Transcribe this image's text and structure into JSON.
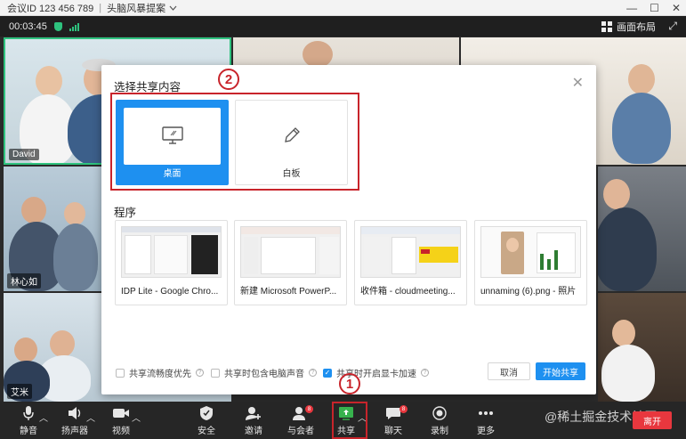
{
  "titlebar": {
    "meeting_id": "会议ID 123 456 789",
    "topic": "头脑风暴提案",
    "chevron": "chevron-down-icon"
  },
  "infobar": {
    "timer": "00:03:45",
    "layout_label": "画面布局"
  },
  "participants": [
    {
      "name": "David"
    },
    {
      "name": "林心如"
    },
    {
      "name": "艾米"
    }
  ],
  "dialog": {
    "title": "选择共享内容",
    "options": [
      {
        "label": "桌面",
        "icon": "monitor-icon",
        "selected": true
      },
      {
        "label": "白板",
        "icon": "pen-icon",
        "selected": false
      }
    ],
    "programs_label": "程序",
    "programs": [
      {
        "label": "IDP Lite - Google Chro..."
      },
      {
        "label": "新建 Microsoft PowerP..."
      },
      {
        "label": "收件箱 - cloudmeeting..."
      },
      {
        "label": "unnaming (6).png - 照片"
      }
    ],
    "checkboxes": [
      {
        "label": "共享流畅度优先",
        "checked": false
      },
      {
        "label": "共享时包含电脑声音",
        "checked": false
      },
      {
        "label": "共享时开启显卡加速",
        "checked": true
      }
    ],
    "cancel_label": "取消",
    "start_label": "开始共享"
  },
  "annotations": {
    "step1": "1",
    "step2": "2"
  },
  "toolbar": {
    "items": [
      {
        "label": "静音",
        "icon": "microphone-icon"
      },
      {
        "label": "扬声器",
        "icon": "speaker-icon"
      },
      {
        "label": "视频",
        "icon": "camera-icon"
      },
      {
        "label": "安全",
        "icon": "shield-icon"
      },
      {
        "label": "邀请",
        "icon": "invite-icon"
      },
      {
        "label": "与会者",
        "icon": "participants-icon"
      },
      {
        "label": "共享",
        "icon": "share-icon"
      },
      {
        "label": "聊天",
        "icon": "chat-icon"
      },
      {
        "label": "录制",
        "icon": "record-icon"
      },
      {
        "label": "更多",
        "icon": "more-icon"
      }
    ],
    "participants_count": "8",
    "chat_count": "8",
    "end_label": "离开"
  },
  "watermark": "@稀土掘金技术社区",
  "colors": {
    "accent": "#1e90f0",
    "annotation_red": "#c8242b",
    "end_red": "#e8373e",
    "toolbar_bg": "#262626"
  }
}
